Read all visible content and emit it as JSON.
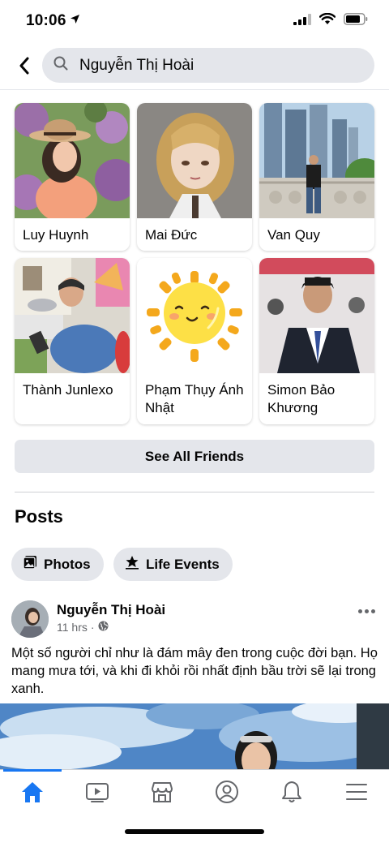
{
  "status_bar": {
    "time": "10:06"
  },
  "search": {
    "query": "Nguyễn Thị Hoài"
  },
  "friends": [
    {
      "name": "Luy Huynh"
    },
    {
      "name": "Mai Đức"
    },
    {
      "name": "Van Quy"
    },
    {
      "name": "Thành Junlexo"
    },
    {
      "name": "Phạm Thụy Ánh Nhật"
    },
    {
      "name": "Simon Bảo Khương"
    }
  ],
  "see_all_label": "See All Friends",
  "posts": {
    "heading": "Posts",
    "chips": {
      "photos": "Photos",
      "life_events": "Life Events"
    }
  },
  "post": {
    "author": "Nguyễn Thị Hoài",
    "time": "11 hrs",
    "separator": "·",
    "privacy_icon": "globe-icon",
    "text": "Một số người chỉ như là đám mây đen trong cuộc đời bạn. Họ mang mưa tới, và khi đi khỏi rồi nhất định bầu trời sẽ lại trong xanh."
  },
  "tab_bar": {
    "tabs": [
      "home-icon",
      "watch-icon",
      "marketplace-icon",
      "profile-icon",
      "notifications-icon",
      "menu-icon"
    ],
    "active": "home-icon",
    "active_color": "#1877f2",
    "inactive_color": "#65676b"
  }
}
